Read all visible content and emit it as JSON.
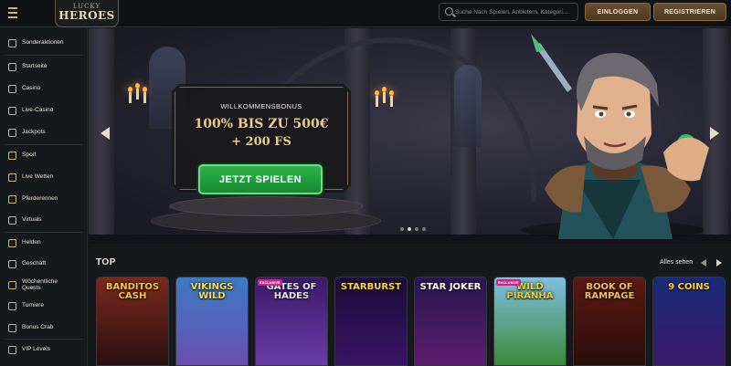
{
  "logo": {
    "top": "LUCKY",
    "bottom": "HEROES"
  },
  "search": {
    "placeholder": "Suche Nach Spielen, Anbietern, Kategori..."
  },
  "auth": {
    "login": "EINLOGGEN",
    "register": "REGISTRIEREN"
  },
  "sidebar": {
    "items": [
      {
        "label": "Sonderaktionen",
        "icon": "gift-icon"
      },
      {
        "label": "Startseite",
        "icon": "home-icon"
      },
      {
        "label": "Casino",
        "icon": "casino-icon"
      },
      {
        "label": "Live-Casino",
        "icon": "live-casino-icon"
      },
      {
        "label": "Jackpots",
        "icon": "jackpot-icon"
      },
      {
        "label": "Sport",
        "icon": "sport-icon"
      },
      {
        "label": "Live Wetten",
        "icon": "live-bet-icon"
      },
      {
        "label": "Pferderennen",
        "icon": "horse-icon"
      },
      {
        "label": "Virtuals",
        "icon": "virtuals-icon"
      },
      {
        "label": "Helden",
        "icon": "hero-icon"
      },
      {
        "label": "Geschäft",
        "icon": "shop-icon"
      },
      {
        "label": "Wöchentliche Quests",
        "icon": "quest-icon"
      },
      {
        "label": "Turniere",
        "icon": "trophy-icon"
      },
      {
        "label": "Bonus Crab",
        "icon": "crab-icon"
      },
      {
        "label": "VIP Levels",
        "icon": "vip-icon"
      }
    ]
  },
  "hero": {
    "subtitle": "WILLKOMMENSBONUS",
    "headline": "100% BIS ZU 500€",
    "freespins": "+ 200 FS",
    "cta": "JETZT SPIELEN",
    "slides": 4,
    "active_slide": 1
  },
  "games_row": {
    "title": "TOP",
    "see_all": "Alles sehen",
    "games": [
      {
        "title": "BANDITOS CASH",
        "bg_top": "#7a2a1d",
        "bg_bottom": "#2a0f10",
        "color": "#f7c64c",
        "badge": ""
      },
      {
        "title": "VIKINGS WILD",
        "bg_top": "#3d7ac4",
        "bg_bottom": "#6a4fb0",
        "color": "#f4e05a",
        "badge": ""
      },
      {
        "title": "GATES OF HADES",
        "bg_top": "#3b1a6a",
        "bg_bottom": "#6b3ca8",
        "color": "#e9e1ff",
        "badge": "EXCLUSIVE"
      },
      {
        "title": "STARBURST",
        "bg_top": "#1a0c3a",
        "bg_bottom": "#3a1466",
        "color": "#ffd84a",
        "badge": ""
      },
      {
        "title": "STAR JOKER",
        "bg_top": "#2a1650",
        "bg_bottom": "#5a1e6e",
        "color": "#ffffff",
        "badge": ""
      },
      {
        "title": "WILD PIRANHA",
        "bg_top": "#7fbfe0",
        "bg_bottom": "#3a8a3a",
        "color": "#e8d23a",
        "badge": "EXCLUSIVE"
      },
      {
        "title": "BOOK OF RAMPAGE",
        "bg_top": "#5a1a14",
        "bg_bottom": "#2a0d0a",
        "color": "#f0c060",
        "badge": ""
      },
      {
        "title": "9 COINS",
        "bg_top": "#1a2a7a",
        "bg_bottom": "#3a1a6a",
        "color": "#ffd23a",
        "badge": ""
      }
    ]
  }
}
